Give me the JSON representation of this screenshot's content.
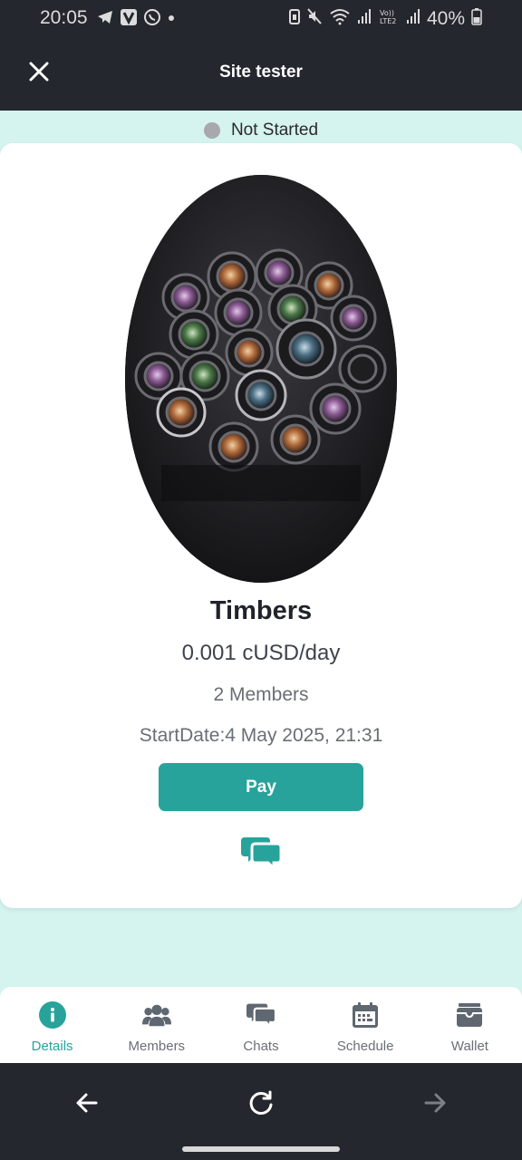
{
  "status_bar": {
    "time": "20:05",
    "battery": "40%",
    "notification_icons": [
      "telegram-icon",
      "viber-icon",
      "whatsapp-icon",
      "dot-icon"
    ],
    "system_icons": [
      "battery-saver-icon",
      "mute-icon",
      "wifi-icon",
      "signal-icon",
      "volte-icon",
      "signal-icon",
      "battery-icon"
    ]
  },
  "app_bar": {
    "title": "Site tester",
    "close_icon": "close-icon"
  },
  "group_status": {
    "label": "Not Started",
    "color": "#a8a8ae"
  },
  "group": {
    "name": "Timbers",
    "price": "0.001 cUSD/day",
    "members": "2 Members",
    "start_date": "StartDate:4 May 2025, 21:31",
    "image_alt": "camera lenses photo"
  },
  "actions": {
    "pay_label": "Pay",
    "chat_icon": "chat-bubbles-icon"
  },
  "bottom_nav": {
    "items": [
      {
        "label": "Details",
        "icon": "info-icon",
        "active": true
      },
      {
        "label": "Members",
        "icon": "members-icon",
        "active": false
      },
      {
        "label": "Chats",
        "icon": "chats-icon",
        "active": false
      },
      {
        "label": "Schedule",
        "icon": "calendar-icon",
        "active": false
      },
      {
        "label": "Wallet",
        "icon": "wallet-icon",
        "active": false
      }
    ]
  },
  "system_nav": {
    "back_icon": "back-arrow-icon",
    "reload_icon": "reload-icon",
    "forward_icon": "forward-arrow-icon"
  },
  "colors": {
    "accent": "#27a39c",
    "header_bg": "#24272e",
    "page_bg": "#d5f3ef"
  }
}
